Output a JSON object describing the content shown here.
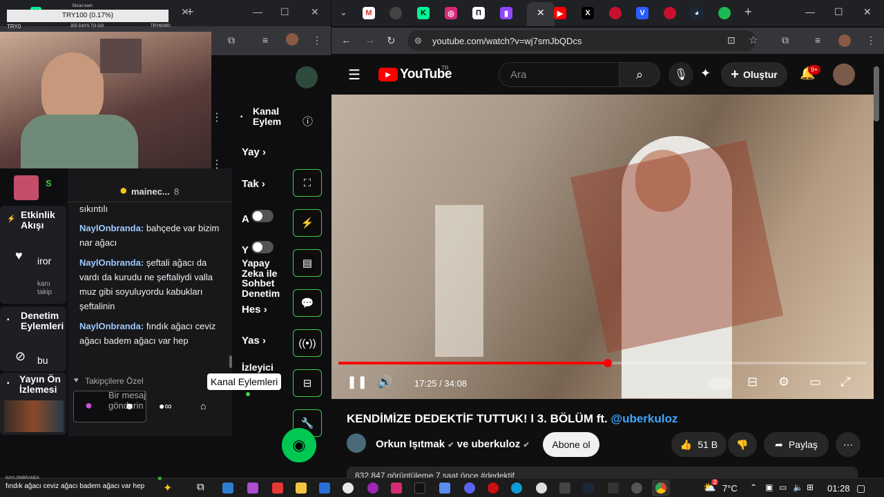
{
  "stream_overlay": {
    "title": "Ekran kartı",
    "bar_text": "TRY100 (0.17%)",
    "left_label": "TRY0",
    "days_label": "355 DAYS TO GO",
    "right_label": "TRY60000"
  },
  "left_browser": {
    "nav_events": "Etkinlik Akışı",
    "nav_events_user": "iror",
    "nav_events_sub": "kanı takip",
    "nav_mod": "Denetim Eylemleri",
    "nav_mod_sub": "bu",
    "nav_preview": "Yayın Ön İzlemesi",
    "chat_header": "mainec...",
    "chat_header_count": "8",
    "chat_top_fragment": "sıkıntılı",
    "messages": [
      {
        "user": "NaylOnbranda:",
        "text": "bahçede var bizim nar ağacı"
      },
      {
        "user": "NaylOnbranda:",
        "text": "şeftali ağacı da vardı da kurudu ne şeftaliydi valla muz gibi soyuluyordu kabukları şeftalinin"
      },
      {
        "user": "NaylOnbranda:",
        "text": "fındık ağacı ceviz ağacı badem ağacı var hep"
      }
    ],
    "followers_only": "Takipçilere Özel",
    "send_placeholder": "Bir mesaj gönderin",
    "mid_header": "Kanal Eylem",
    "mid_items": [
      "Yay",
      "Tak",
      "A",
      "Y",
      "Hes",
      "Yas"
    ],
    "mid_ai": "Yapay Zeka ile Sohbet Denetim",
    "mid_viewer": "İzleyici",
    "tooltip": "Kanal Eylemleri",
    "side_label_s": "S"
  },
  "right_browser": {
    "url": "youtube.com/watch?v=wj7smJbQDcs",
    "logo": "YouTube",
    "logo_region": "TR",
    "search_placeholder": "Ara",
    "create_label": "Oluştur",
    "notif_count": "9+",
    "time_current": "17:25",
    "time_total": "34:08",
    "progress": 0.51,
    "video_title": "KENDİMİZE DEDEKTİF TUTTUK! l 3. BÖLÜM ft.",
    "video_title_mention": "@uberkuloz",
    "channel1": "Orkun Işıtmak",
    "channel_and": "ve uberkuloz",
    "subscribe": "Abone ol",
    "likes": "51 B",
    "share": "Paylaş",
    "views_partial": "832.847 görüntüleme  7 saat önce  #dedektif"
  },
  "taskbar": {
    "notification_user": "NAYLONBRANDA",
    "notification_text": "fındık ağacı ceviz ağacı badem ağacı var hep",
    "weather_temp": "7°C",
    "weather_badge": "2",
    "clock": "01:28"
  },
  "colors": {
    "yt_red": "#ff0000",
    "twitch_green": "#3fce43",
    "twitch_purple": "#9147ff",
    "chat_name": "#9ecbff"
  }
}
